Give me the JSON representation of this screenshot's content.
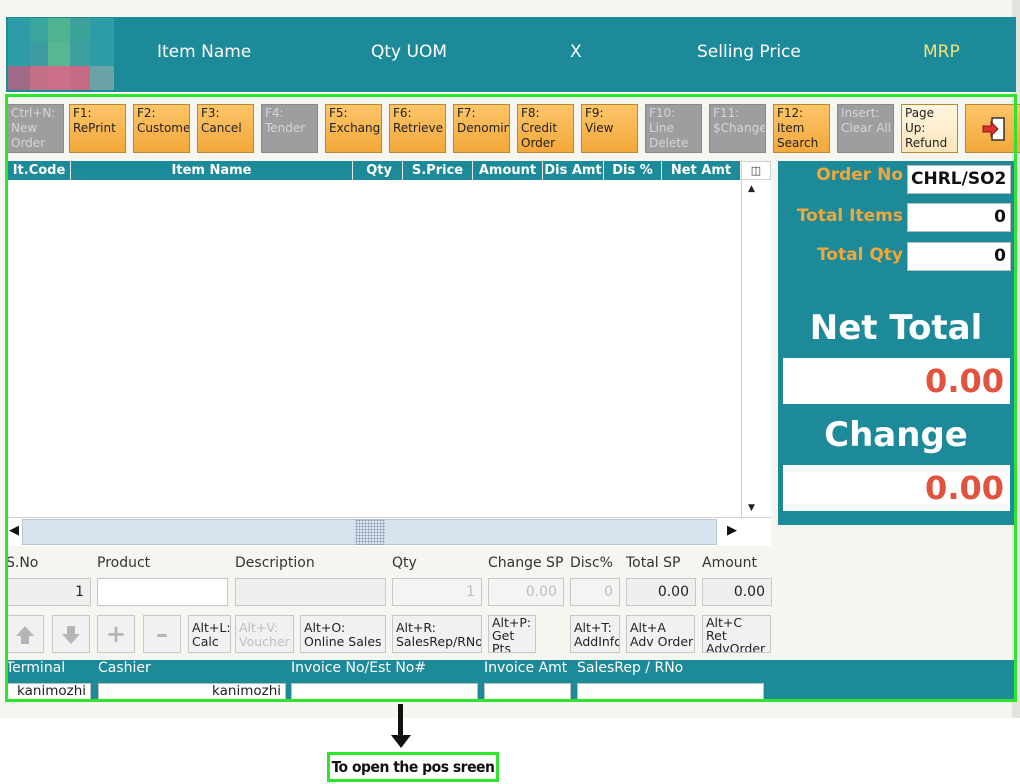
{
  "header": {
    "item_name": "Item Name",
    "qty_uom": "Qty UOM",
    "x": "X",
    "selling_price": "Selling Price",
    "mrp": "MRP"
  },
  "toolbar": [
    {
      "label": "Ctrl+N:\nNew\nOrder",
      "enabled": false
    },
    {
      "label": "F1:\nRePrint",
      "enabled": true
    },
    {
      "label": "F2:\nCustome",
      "enabled": true
    },
    {
      "label": "F3:\nCancel",
      "enabled": true
    },
    {
      "label": "F4:\nTender",
      "enabled": false
    },
    {
      "label": "F5:\nExchang",
      "enabled": true
    },
    {
      "label": "F6:\nRetrieve",
      "enabled": true
    },
    {
      "label": "F7:\nDenomin",
      "enabled": true
    },
    {
      "label": "F8:\nCredit\nOrder",
      "enabled": true
    },
    {
      "label": "F9:\nView",
      "enabled": true
    },
    {
      "label": "F10:\nLine\nDelete",
      "enabled": false
    },
    {
      "label": "F11:\n$Change",
      "enabled": false
    },
    {
      "label": "F12:\nItem\nSearch",
      "enabled": true
    },
    {
      "label": "Insert:\nClear All",
      "enabled": false
    },
    {
      "label": "Page\nUp:\nRefund",
      "enabled": true
    },
    {
      "label": "",
      "icon": "exit-icon",
      "enabled": true
    }
  ],
  "grid": {
    "columns": [
      "It.Code",
      "Item Name",
      "Qty",
      "S.Price",
      "Amount",
      "Dis Amt",
      "Dis %",
      "Net Amt"
    ],
    "rows": []
  },
  "summary": {
    "order_no_label": "Order No",
    "order_no": "CHRL/SO2",
    "total_items_label": "Total Items",
    "total_items": "0",
    "total_qty_label": "Total Qty",
    "total_qty": "0",
    "net_total_label": "Net Total",
    "net_total": "0.00",
    "change_label": "Change",
    "change": "0.00"
  },
  "entry": {
    "labels": {
      "sno": "S.No",
      "product": "Product",
      "description": "Description",
      "qty": "Qty",
      "change_sp": "Change SP",
      "disc": "Disc%",
      "total_sp": "Total SP",
      "amount": "Amount"
    },
    "values": {
      "sno": "1",
      "product": "",
      "description": "",
      "qty": "1",
      "change_sp": "0.00",
      "disc": "0",
      "total_sp": "0.00",
      "amount": "0.00"
    }
  },
  "action_buttons": [
    {
      "label": "Alt+L:\nCalc",
      "enabled": true
    },
    {
      "label": "Alt+V:\nVoucher",
      "enabled": false
    },
    {
      "label": "Alt+O:\nOnline Sales",
      "enabled": true
    },
    {
      "label": "Alt+R:\nSalesRep/RNo",
      "enabled": true
    },
    {
      "label": "Alt+P:\nGet\nPts",
      "enabled": true
    },
    {
      "label": "Alt+T:\nAddInfo",
      "enabled": true
    },
    {
      "label": "Alt+A\nAdv Order",
      "enabled": true
    },
    {
      "label": "Alt+C\nRet\nAdvOrder",
      "enabled": true
    }
  ],
  "status_bar": {
    "terminal_label": "Terminal",
    "terminal": "kanimozhi",
    "cashier_label": "Cashier",
    "cashier": "kanimozhi",
    "invoice_no_label": "Invoice No/Est No#",
    "invoice_no": "",
    "invoice_amt_label": "Invoice Amt",
    "invoice_amt": "",
    "salesrep_label": "SalesRep / RNo",
    "salesrep": ""
  },
  "annotation": {
    "callout": "To open the pos sreen"
  },
  "colors": {
    "teal": "#1d8a99",
    "orange_button": "#f3a83b",
    "label_orange": "#f2a73b",
    "total_red": "#e2533e",
    "highlight_green": "#2ee52e"
  }
}
